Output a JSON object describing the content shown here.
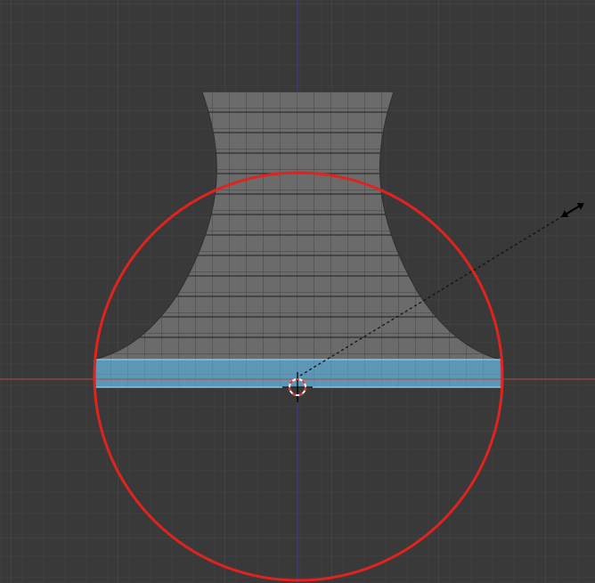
{
  "viewport": {
    "colors": {
      "background": "#393939",
      "grid_minor": "#414141",
      "grid_major": "#4a4a4a",
      "axis_x": "#b04848",
      "axis_z": "#3c3c9a",
      "mesh_fill": "#6b6b6b",
      "mesh_edge": "#2e2e2e",
      "selected_face": "#5d97b5",
      "selected_edge": "#7cc8e8",
      "brush_circle": "#e0231e",
      "pivot": "#ffffff",
      "pivot_dash": "#e03030"
    },
    "icons": {
      "resize_cursor": "double-arrow-cursor-icon",
      "pivot": "3d-cursor-icon"
    }
  }
}
